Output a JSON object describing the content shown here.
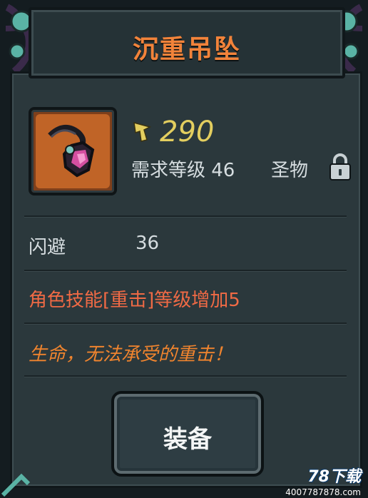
{
  "header": {
    "title": "沉重吊坠"
  },
  "item": {
    "icon": "pendant-icon",
    "price": "290",
    "price_icon": "currency-icon",
    "level_requirement": "需求等级 46",
    "rarity": "圣物",
    "lock_icon": "lock-icon"
  },
  "stats": [
    {
      "name": "闪避",
      "value": "36"
    }
  ],
  "effect_text": "角色技能[重击]等级增加5",
  "flavor_text": "生命，无法承受的重击！",
  "actions": {
    "equip_label": "装备"
  },
  "watermark": {
    "brand": "78下载",
    "url": "4007787878.com"
  },
  "colors": {
    "title": "#f2833a",
    "price": "#e3ce5f",
    "effect": "#f06a45",
    "flavor": "#f0842e",
    "item_frame": "#c9682a"
  }
}
